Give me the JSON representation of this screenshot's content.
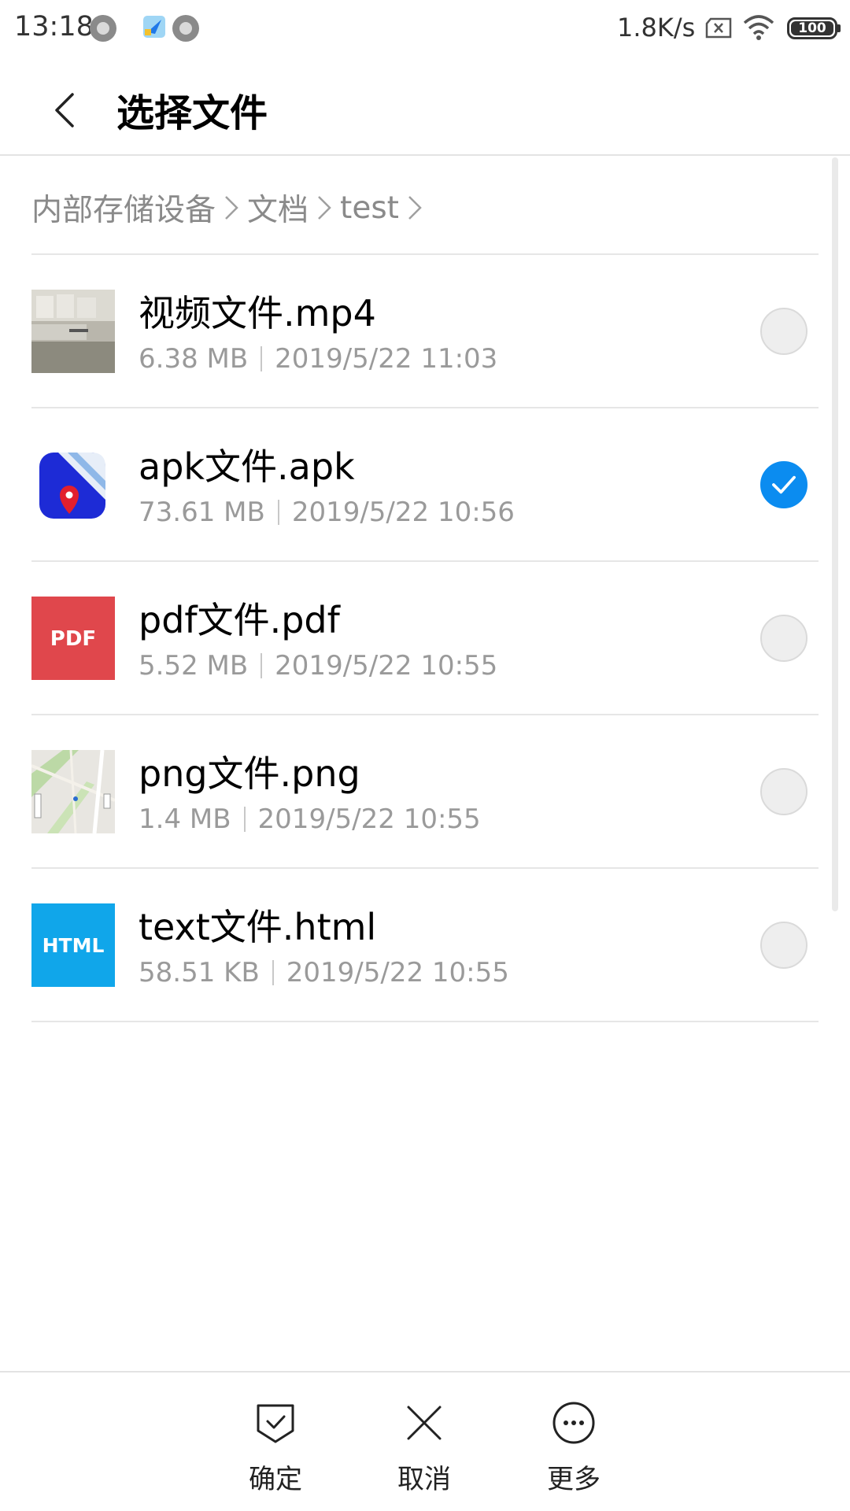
{
  "status_bar": {
    "time": "13:18",
    "net_speed": "1.8K/s",
    "battery": "100",
    "icons": [
      "circle-notification-icon",
      "app-notification-icon",
      "circle-notification-icon",
      "sim-x-icon",
      "wifi-icon",
      "battery-icon"
    ]
  },
  "title_bar": {
    "title": "选择文件",
    "back_icon": "chevron-left-icon"
  },
  "breadcrumb": {
    "items": [
      "内部存储设备",
      "文档",
      "test"
    ],
    "separator_icon": "chevron-right-icon"
  },
  "files": [
    {
      "name": "视频文件.mp4",
      "size": "6.38 MB",
      "date": "2019/5/22 11:03",
      "selected": false,
      "thumb": "video-thumbnail"
    },
    {
      "name": "apk文件.apk",
      "size": "73.61 MB",
      "date": "2019/5/22 10:56",
      "selected": true,
      "thumb": "app-icon"
    },
    {
      "name": "pdf文件.pdf",
      "size": "5.52 MB",
      "date": "2019/5/22 10:55",
      "selected": false,
      "thumb": "pdf-icon",
      "badge": "PDF"
    },
    {
      "name": "png文件.png",
      "size": "1.4 MB",
      "date": "2019/5/22 10:55",
      "selected": false,
      "thumb": "map-image-thumbnail"
    },
    {
      "name": "text文件.html",
      "size": "58.51 KB",
      "date": "2019/5/22 10:55",
      "selected": false,
      "thumb": "html-icon",
      "badge": "HTML"
    }
  ],
  "bottom_bar": {
    "confirm_label": "确定",
    "cancel_label": "取消",
    "more_label": "更多"
  },
  "colors": {
    "accent": "#0b8cf0",
    "pdf_badge": "#e0474c",
    "html_badge": "#10a6ea",
    "secondary_text": "#9a9a9a"
  }
}
